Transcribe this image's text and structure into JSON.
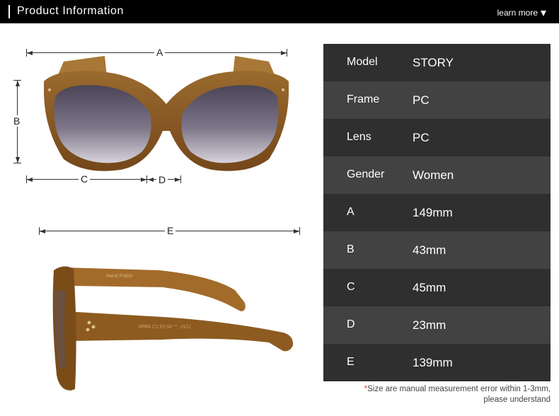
{
  "header": {
    "title": "Product Information",
    "more_label": "learn more"
  },
  "dimension_labels": {
    "a": "A",
    "b": "B",
    "c": "C",
    "d": "D",
    "e": "E"
  },
  "spec_table": [
    {
      "key": "Model",
      "value": "STORY"
    },
    {
      "key": "Frame",
      "value": "PC"
    },
    {
      "key": "Lens",
      "value": "PC"
    },
    {
      "key": "Gender",
      "value": "Women"
    },
    {
      "key": "A",
      "value": "149mm"
    },
    {
      "key": "B",
      "value": "43mm"
    },
    {
      "key": "C",
      "value": "45mm"
    },
    {
      "key": "D",
      "value": "23mm"
    },
    {
      "key": "E",
      "value": "139mm"
    }
  ],
  "temple_inscriptions": {
    "outer": "Hand Polish",
    "inner": "7157 — 45-23 C2 Made"
  },
  "note": {
    "star": "*",
    "line1": "Size are manual measurement error within 1-3mm,",
    "line2": "please understand"
  },
  "colors": {
    "frame": "#8a5a22",
    "frame_dark": "#6b4215",
    "lens": "#5a5466",
    "row_dark": "#2f2f2f",
    "row_light": "#424242"
  }
}
